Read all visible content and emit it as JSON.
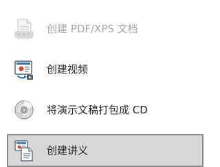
{
  "menu": {
    "items": [
      {
        "label": "创建 PDF/XPS 文档",
        "icon": "pdf-document-icon",
        "state": "disabled"
      },
      {
        "label": "创建视频",
        "icon": "video-presentation-icon",
        "state": "normal"
      },
      {
        "label": "将演示文稿打包成 CD",
        "icon": "cd-disc-icon",
        "state": "normal"
      },
      {
        "label": "创建讲义",
        "icon": "handouts-icon",
        "state": "selected"
      }
    ]
  },
  "colors": {
    "text": "#262626",
    "disabled_text": "#a6a6a6",
    "selected_background": "#d8d8d8",
    "selected_border": "#8a8a8a"
  }
}
